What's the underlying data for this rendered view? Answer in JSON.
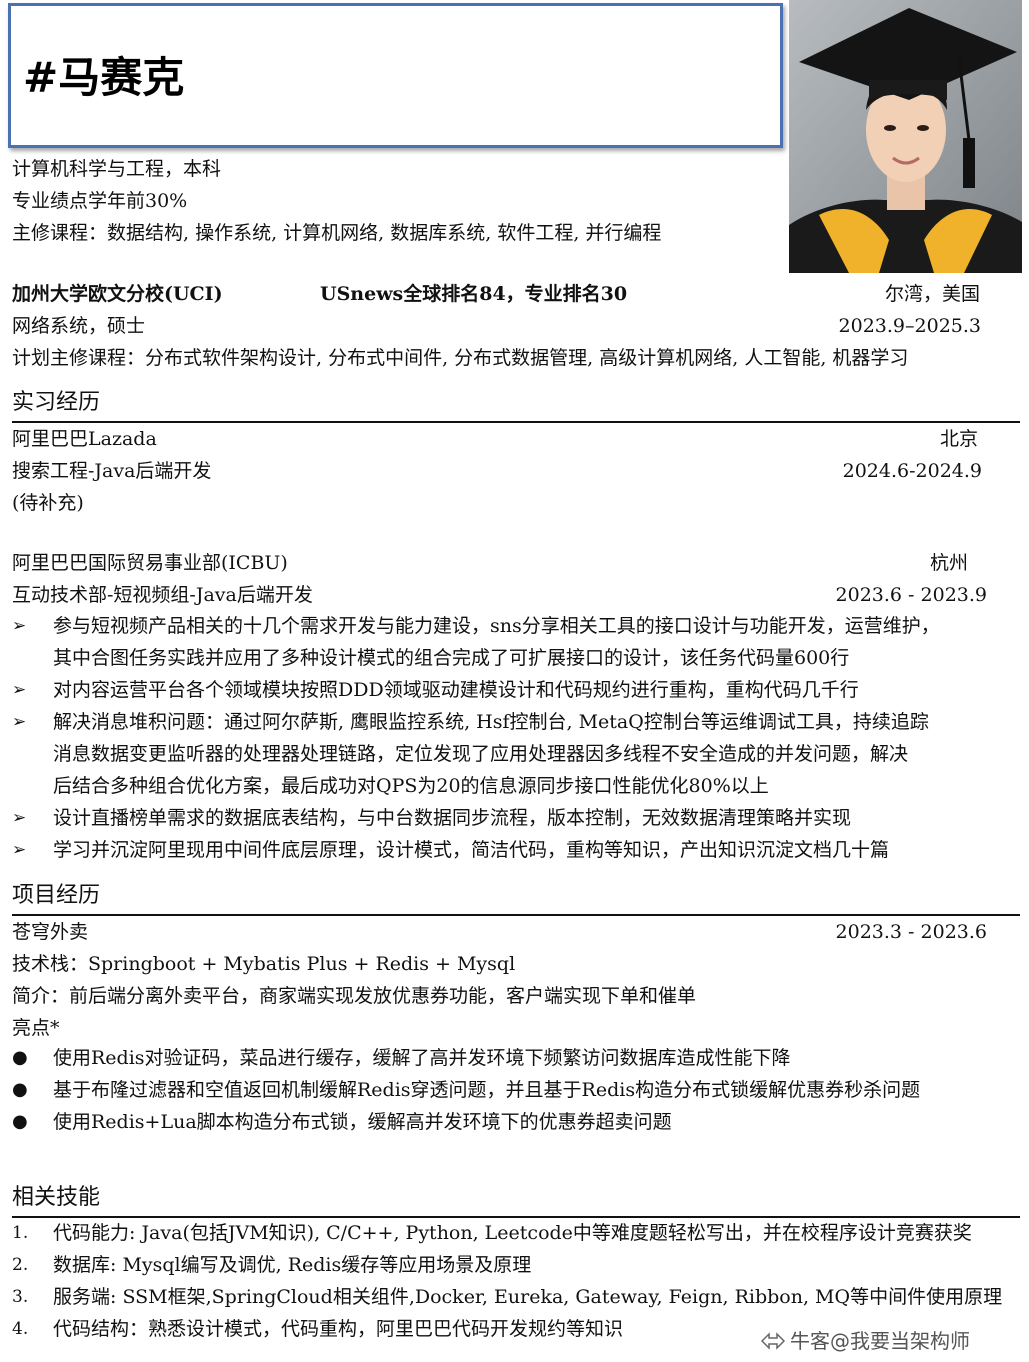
{
  "header": {
    "name": "#马赛克"
  },
  "education": {
    "undergrad": {
      "major": "计算机科学与工程，本科",
      "gpa": "专业绩点学年前30%",
      "courses": "主修课程：数据结构, 操作系统, 计算机网络, 数据库系统, 软件工程, 并行编程"
    },
    "grad": {
      "school": "加州大学欧文分校(UCI)",
      "ranking": "USnews全球排名84，专业排名30",
      "location": "尔湾，美国",
      "degree": "网络系统，硕士",
      "period": "2023.9–2025.3",
      "courses": "计划主修课程：分布式软件架构设计, 分布式中间件, 分布式数据管理, 高级计算机网络, 人工智能, 机器学习"
    }
  },
  "internship": {
    "title": "实习经历",
    "items": [
      {
        "company": "阿里巴巴Lazada",
        "location": "北京",
        "role": "搜索工程-Java后端开发",
        "period": "2024.6-2024.9",
        "note": "(待补充)"
      },
      {
        "company": "阿里巴巴国际贸易事业部(ICBU)",
        "location": "杭州",
        "role": "互动技术部-短视频组-Java后端开发",
        "period": "2023.6 - 2023.9",
        "bullets": [
          "参与短视频产品相关的十几个需求开发与能力建设，sns分享相关工具的接口设计与功能开发，运营维护，",
          "其中合图任务实践并应用了多种设计模式的组合完成了可扩展接口的设计，该任务代码量600行",
          "对内容运营平台各个领域模块按照DDD领域驱动建模设计和代码规约进行重构，重构代码几千行",
          "解决消息堆积问题：通过阿尔萨斯, 鹰眼监控系统, Hsf控制台, MetaQ控制台等运维调试工具，持续追踪",
          "消息数据变更监听器的处理器处理链路，定位发现了应用处理器因多线程不安全造成的并发问题，解决",
          "后结合多种组合优化方案，最后成功对QPS为20的信息源同步接口性能优化80%以上",
          "设计直播榜单需求的数据底表结构，与中台数据同步流程，版本控制，无效数据清理策略并实现",
          "学习并沉淀阿里现用中间件底层原理，设计模式，简洁代码，重构等知识，产出知识沉淀文档几十篇"
        ]
      }
    ]
  },
  "projects": {
    "title": "项目经历",
    "name": "苍穹外卖",
    "period": "2023.3 - 2023.6",
    "stack": "技术栈：Springboot + Mybatis Plus + Redis + Mysql",
    "intro": "简介：前后端分离外卖平台，商家端实现发放优惠券功能，客户端实现下单和催单",
    "highlights_label": "亮点*",
    "highlights": [
      "使用Redis对验证码，菜品进行缓存，缓解了高并发环境下频繁访问数据库造成性能下降",
      "基于布隆过滤器和空值返回机制缓解Redis穿透问题，并且基于Redis构造分布式锁缓解优惠券秒杀问题",
      "使用Redis+Lua脚本构造分布式锁，缓解高并发环境下的优惠券超卖问题"
    ]
  },
  "skills": {
    "title": "相关技能",
    "items": [
      {
        "num": "1.",
        "text": "代码能力: Java(包括JVM知识), C/C++, Python, Leetcode中等难度题轻松写出，并在校程序设计竞赛获奖"
      },
      {
        "num": "2.",
        "text": "数据库: Mysql编写及调优, Redis缓存等应用场景及原理"
      },
      {
        "num": "3.",
        "text": "服务端: SSM框架,SpringCloud相关组件,Docker, Eureka, Gateway, Feign, Ribbon, MQ等中间件使用原理"
      },
      {
        "num": "4.",
        "text": "代码结构：熟悉设计模式，代码重构，阿里巴巴代码开发规约等知识"
      }
    ]
  },
  "watermark": "牛客@我要当架构师",
  "glyphs": {
    "arrow": "➢",
    "dot": "●"
  }
}
